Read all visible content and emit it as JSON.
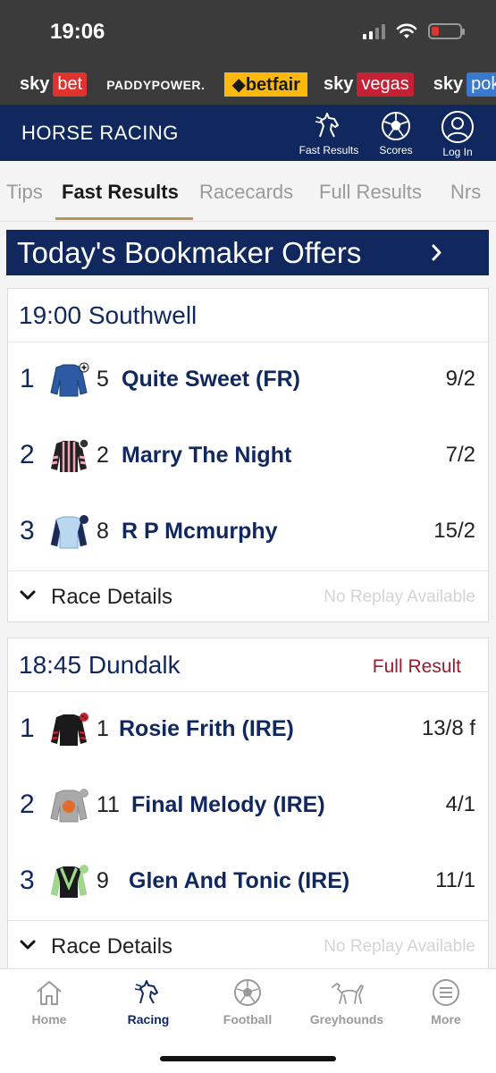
{
  "status": {
    "time": "19:06"
  },
  "brands": [
    {
      "name": "sky",
      "tag": "bet",
      "tag_color": "#e0332f"
    },
    {
      "name": "PADDYPOWER."
    },
    {
      "name": "betfair"
    },
    {
      "name": "sky",
      "tag": "vegas",
      "tag_color": "#c42135"
    },
    {
      "name": "sky",
      "tag": "poker",
      "tag_color": "#3b79d1"
    }
  ],
  "header": {
    "title": "HORSE RACING",
    "buttons": [
      {
        "label": "Fast Results",
        "icon": "horse-head-icon"
      },
      {
        "label": "Scores",
        "icon": "football-icon"
      },
      {
        "label": "Log In",
        "icon": "user-icon"
      }
    ]
  },
  "tabs": [
    {
      "label": "Tips"
    },
    {
      "label": "Fast Results",
      "active": true
    },
    {
      "label": "Racecards"
    },
    {
      "label": "Full Results"
    },
    {
      "label": "Nrs"
    }
  ],
  "offers_banner": {
    "label": "Today's Bookmaker Offers"
  },
  "races": [
    {
      "title": "19:00 Southwell",
      "full_result": "",
      "runners": [
        {
          "pos": "1",
          "draw": "5",
          "horse": "Quite Sweet (FR)",
          "odds": "9/2",
          "silk": "royal-blue-silk"
        },
        {
          "pos": "2",
          "draw": "2",
          "horse": "Marry The Night",
          "odds": "7/2",
          "silk": "black-pink-striped-silk"
        },
        {
          "pos": "3",
          "draw": "8",
          "horse": "R P Mcmurphy",
          "odds": "15/2",
          "silk": "light-blue-navy-silk"
        }
      ],
      "details_label": "Race Details",
      "replay": "No Replay Available"
    },
    {
      "title": "18:45 Dundalk",
      "full_result": "Full Result",
      "runners": [
        {
          "pos": "1",
          "draw": "1",
          "horse": "Rosie Frith (IRE)",
          "odds": "13/8 f",
          "silk": "black-red-silk"
        },
        {
          "pos": "2",
          "draw": "11",
          "horse": "Final Melody (IRE)",
          "odds": "4/1",
          "silk": "grey-orange-disc-silk"
        },
        {
          "pos": "3",
          "draw": "9",
          "horse": "Glen And Tonic (IRE)",
          "odds": "11/1",
          "silk": "black-green-chevron-silk"
        }
      ],
      "details_label": "Race Details",
      "replay": "No Replay Available"
    }
  ],
  "bottom_nav": [
    {
      "label": "Home",
      "icon": "home-icon"
    },
    {
      "label": "Racing",
      "icon": "horse-head-icon",
      "active": true
    },
    {
      "label": "Football",
      "icon": "football-icon"
    },
    {
      "label": "Greyhounds",
      "icon": "greyhound-icon"
    },
    {
      "label": "More",
      "icon": "menu-icon"
    }
  ],
  "colors": {
    "navy": "#10285e",
    "gold": "#b89356",
    "red": "#9b1b2b"
  }
}
